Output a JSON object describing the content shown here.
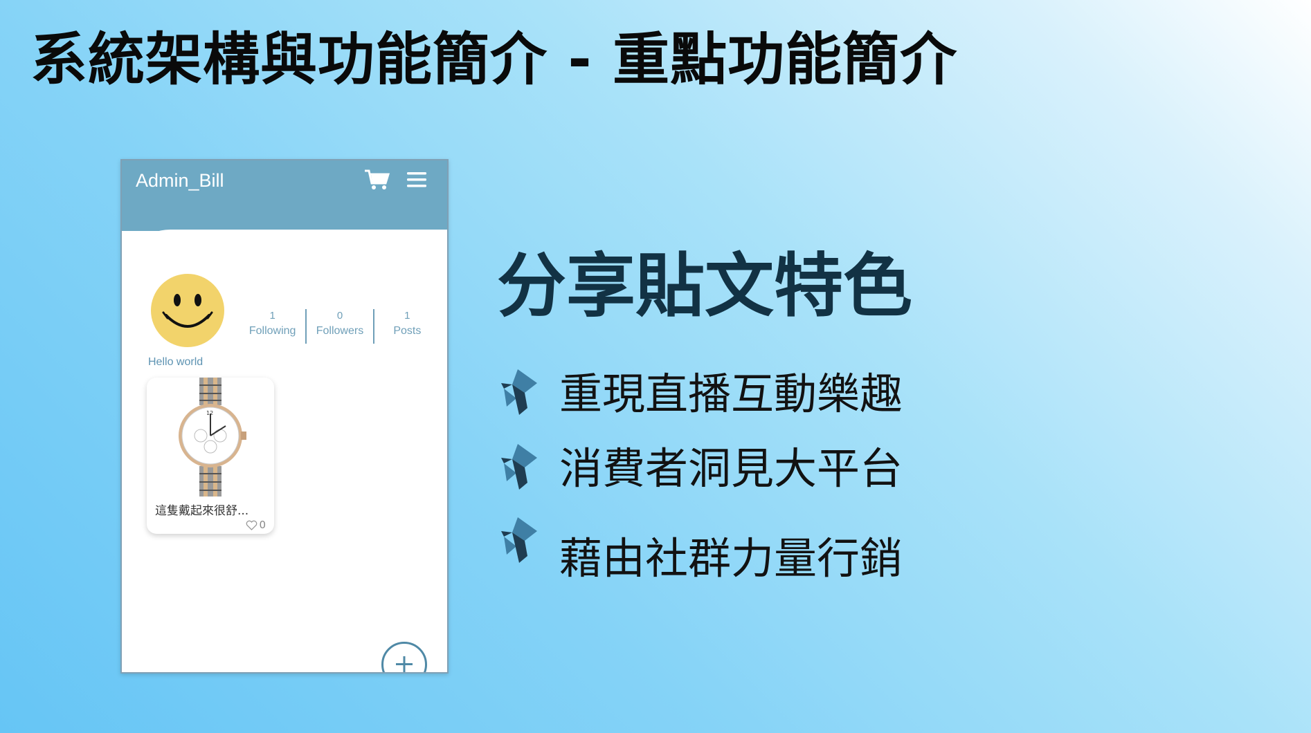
{
  "slide": {
    "title": "系統架構與功能簡介 - 重點功能簡介"
  },
  "phone": {
    "username": "Admin_Bill",
    "stats": [
      {
        "value": "1",
        "label": "Following"
      },
      {
        "value": "0",
        "label": "Followers"
      },
      {
        "value": "1",
        "label": "Posts"
      }
    ],
    "bio": "Hello world",
    "post": {
      "caption": "這隻戴起來很舒...",
      "likes": "0"
    },
    "nav": [
      "home-icon",
      "phone-icon",
      "search-icon",
      "profile-icon"
    ],
    "active_nav": "profile-icon",
    "colors": {
      "header": "#6ea9c4",
      "accent": "#4f89a6",
      "avatar": "#f2d36b"
    }
  },
  "features": {
    "heading": "分享貼文特色",
    "items": [
      "重現直播互動樂趣",
      "消費者洞見大平台",
      "藉由社群力量行銷"
    ]
  }
}
